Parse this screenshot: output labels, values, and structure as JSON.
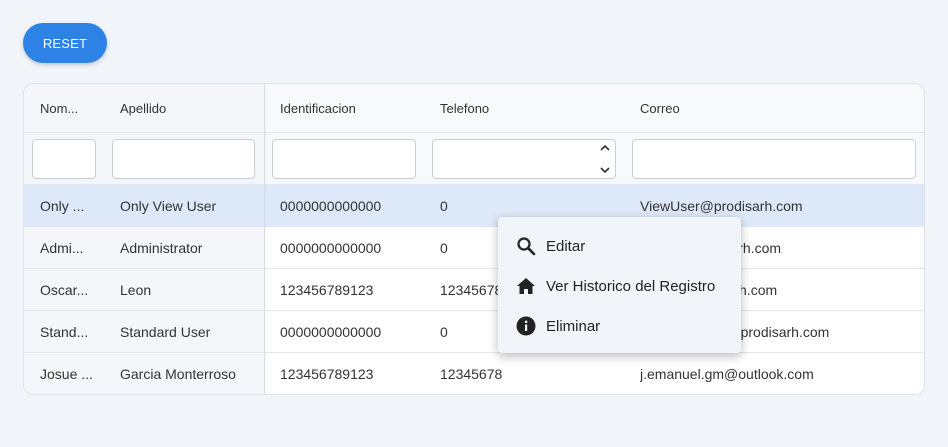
{
  "toolbar": {
    "reset_label": "RESET"
  },
  "colors": {
    "accent": "#2d82e6",
    "selected_row": "#dde9f9",
    "background": "#f1f4f8"
  },
  "table": {
    "columns": [
      "Nom...",
      "Apellido",
      "Identificacion",
      "Telefono",
      "Correo"
    ],
    "rows": [
      {
        "nombre": "Only ...",
        "apellido": "Only View User",
        "identificacion": "0000000000000",
        "telefono": "0",
        "correo": "ViewUser@prodisarh.com"
      },
      {
        "nombre": "Admi...",
        "apellido": "Administrator",
        "identificacion": "0000000000000",
        "telefono": "0",
        "correo": "admin@prodisarh.com"
      },
      {
        "nombre": "Oscar...",
        "apellido": "Leon",
        "identificacion": "123456789123",
        "telefono": "12345678",
        "correo": "oscar@prodisarh.com"
      },
      {
        "nombre": "Stand...",
        "apellido": "Standard User",
        "identificacion": "0000000000000",
        "telefono": "0",
        "correo": "StandardUser@prodisarh.com"
      },
      {
        "nombre": "Josue ...",
        "apellido": "Garcia Monterroso",
        "identificacion": "123456789123",
        "telefono": "12345678",
        "correo": "j.emanuel.gm@outlook.com"
      }
    ]
  },
  "context_menu": {
    "items": [
      {
        "label": "Editar",
        "icon": "search-icon"
      },
      {
        "label": "Ver Historico del Registro",
        "icon": "home-icon"
      },
      {
        "label": "Eliminar",
        "icon": "info-icon"
      }
    ]
  }
}
